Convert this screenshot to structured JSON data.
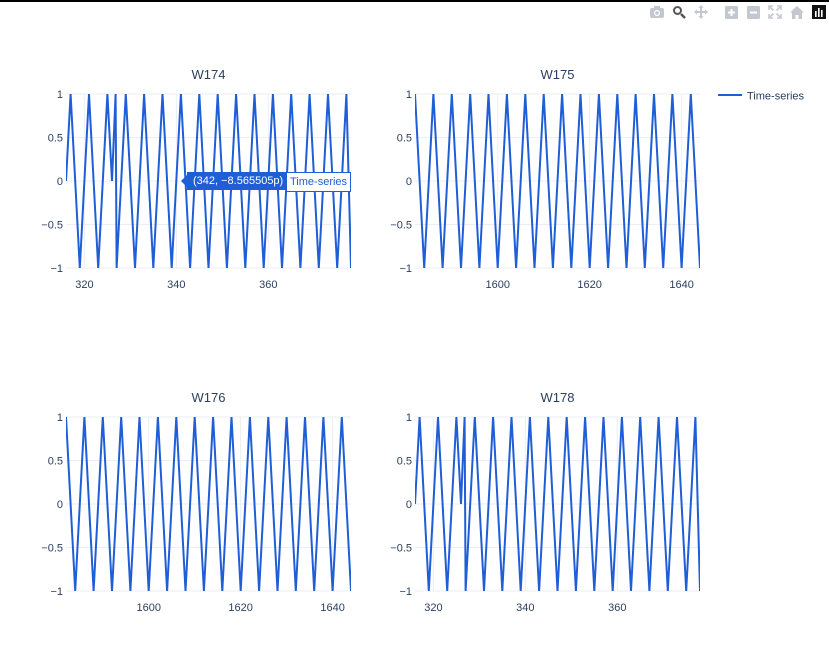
{
  "modebar": {
    "icons": [
      "camera-icon",
      "zoom-icon",
      "pan-icon",
      "zoom-in-icon",
      "zoom-out-icon",
      "autoscale-icon",
      "home-icon",
      "plotly-logo-icon"
    ]
  },
  "legend": {
    "label": "Time-series",
    "color": "#1f5ed6",
    "placement": "top-right"
  },
  "tooltip": {
    "text": "(342, −8.565505p)",
    "name": "Time-series"
  },
  "colors": {
    "line": "#1f5ed6",
    "grid": "#ebeef2",
    "axis_text": "#2a3f5f"
  },
  "chart_data": [
    {
      "type": "line",
      "title": "W174",
      "series_name": "Time-series",
      "xlim": [
        316,
        378
      ],
      "ylim": [
        -1,
        1
      ],
      "xticks": [
        320,
        340,
        360
      ],
      "xtick_labels": [
        "320",
        "340",
        "360"
      ],
      "yticks": [
        1,
        0.5,
        0,
        -0.5,
        -1
      ],
      "ytick_labels": [
        "1",
        "0.5",
        "0",
        "−0.5",
        "−1"
      ],
      "wave": {
        "start": 316,
        "start_y": 0,
        "start_dir": 1,
        "half_period": 2,
        "anomalies": [
          {
            "x_center": 326,
            "y": 0
          }
        ]
      },
      "grid": true
    },
    {
      "type": "line",
      "title": "W175",
      "series_name": "Time-series",
      "xlim": [
        1582,
        1644
      ],
      "ylim": [
        -1,
        1
      ],
      "xticks": [
        1600,
        1620,
        1640
      ],
      "xtick_labels": [
        "1600",
        "1620",
        "1640"
      ],
      "yticks": [
        1,
        0.5,
        0,
        -0.5,
        -1
      ],
      "ytick_labels": [
        "1",
        "0.5",
        "0",
        "−0.5",
        "−1"
      ],
      "wave": {
        "start": 1582,
        "start_y": 1,
        "start_dir": -1,
        "half_period": 2,
        "anomalies": []
      },
      "grid": true
    },
    {
      "type": "line",
      "title": "W176",
      "series_name": "Time-series",
      "xlim": [
        1582,
        1644
      ],
      "ylim": [
        -1,
        1
      ],
      "xticks": [
        1600,
        1620,
        1640
      ],
      "xtick_labels": [
        "1600",
        "1620",
        "1640"
      ],
      "yticks": [
        1,
        0.5,
        0,
        -0.5,
        -1
      ],
      "ytick_labels": [
        "1",
        "0.5",
        "0",
        "−0.5",
        "−1"
      ],
      "wave": {
        "start": 1582,
        "start_y": 1,
        "start_dir": -1,
        "half_period": 2,
        "anomalies": []
      },
      "grid": true
    },
    {
      "type": "line",
      "title": "W178",
      "series_name": "Time-series",
      "xlim": [
        316,
        378
      ],
      "ylim": [
        -1,
        1
      ],
      "xticks": [
        320,
        340,
        360
      ],
      "xtick_labels": [
        "320",
        "340",
        "360"
      ],
      "yticks": [
        1,
        0.5,
        0,
        -0.5,
        -1
      ],
      "ytick_labels": [
        "1",
        "0.5",
        "0",
        "−0.5",
        "−1"
      ],
      "wave": {
        "start": 316,
        "start_y": 0,
        "start_dir": 1,
        "half_period": 2,
        "anomalies": [
          {
            "x_center": 326,
            "y": 0
          }
        ]
      },
      "grid": true
    }
  ]
}
